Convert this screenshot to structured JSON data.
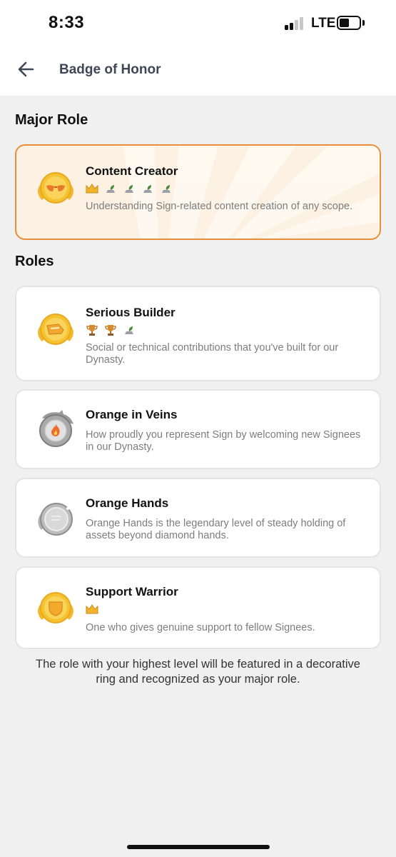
{
  "status_bar": {
    "time": "8:33",
    "network": "LTE",
    "signal_bars": 2,
    "battery_level": 0.4
  },
  "header": {
    "title": "Badge of Honor",
    "back_icon": "arrow-left-icon"
  },
  "major_section": {
    "title": "Major Role"
  },
  "major_role": {
    "name": "Content Creator",
    "description": "Understanding Sign-related content creation of any scope.",
    "levels": [
      "crown-icon",
      "sprout-icon",
      "sprout-icon",
      "sprout-icon",
      "sprout-icon"
    ],
    "badge_icon": "sunglasses-badge-icon"
  },
  "roles_section": {
    "title": "Roles"
  },
  "roles": [
    {
      "name": "Serious Builder",
      "description": "Social or technical contributions that you've built for our Dynasty.",
      "levels": [
        "trophy-icon",
        "trophy-icon",
        "sprout-icon"
      ],
      "badge_icon": "builder-badge-icon"
    },
    {
      "name": "Orange in Veins",
      "description": "How proudly you represent Sign by welcoming new Signees in our Dynasty.",
      "levels": [],
      "badge_icon": "dragon-flame-badge-icon"
    },
    {
      "name": "Orange Hands",
      "description": "Orange Hands is the legendary level of steady holding of assets beyond diamond hands.",
      "levels": [],
      "badge_icon": "silver-coin-badge-icon"
    },
    {
      "name": "Support Warrior",
      "description": "One who gives genuine support to fellow Signees.",
      "levels": [
        "crown-icon"
      ],
      "badge_icon": "shield-badge-icon"
    }
  ],
  "footer": {
    "note": "The role with your highest level will be featured in a decorative ring and recognized as your major role."
  },
  "colors": {
    "accent": "#e98f3c",
    "major_bg": "#fcf1e2",
    "gold": "#f5c232",
    "page_bg": "#f0f0f0"
  }
}
